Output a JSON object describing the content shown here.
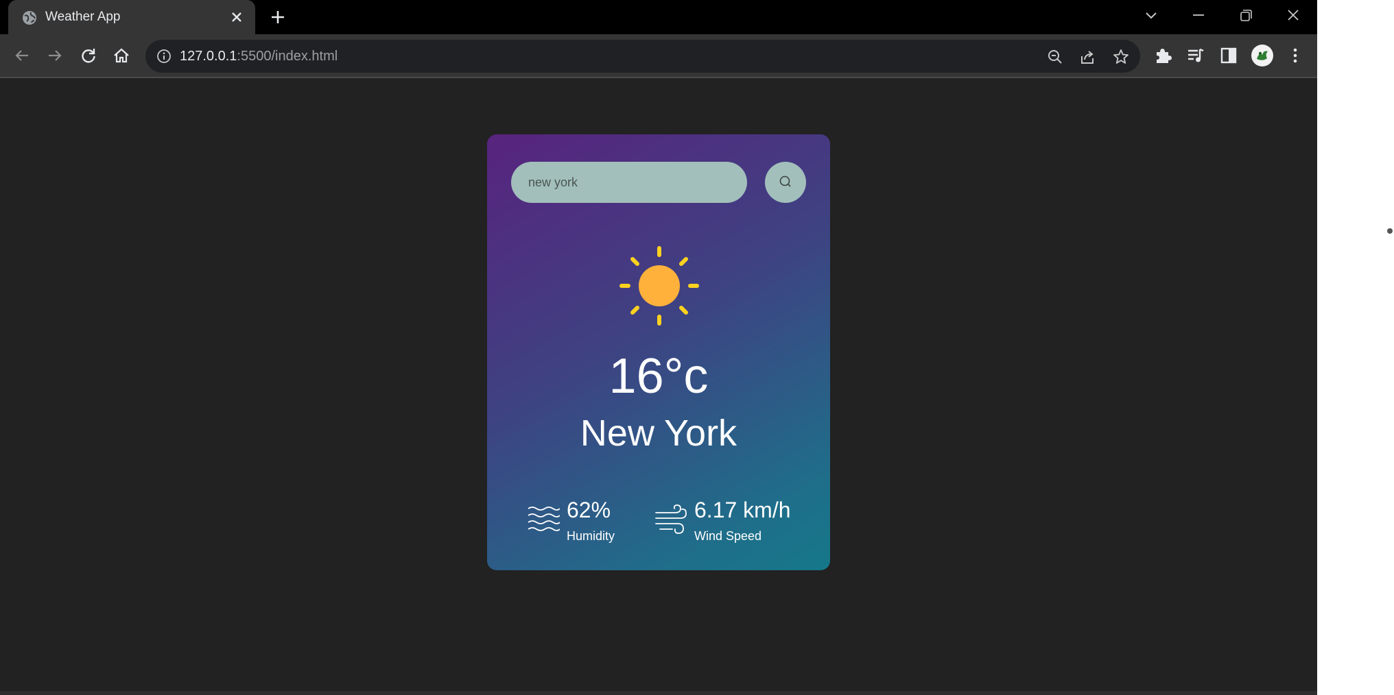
{
  "browser": {
    "tab_title": "Weather App",
    "url_host": "127.0.0.1",
    "url_rest": ":5500/index.html"
  },
  "app": {
    "search": {
      "value": "new york"
    },
    "temperature": "16°c",
    "city": "New York",
    "humidity": {
      "value": "62%",
      "label": "Humidity"
    },
    "wind": {
      "value": "6.17 km/h",
      "label": "Wind Speed"
    }
  },
  "icons": {
    "tab_favicon": "globe-icon",
    "tab_close": "close-icon",
    "new_tab": "plus-icon",
    "back": "arrow-left-icon",
    "forward": "arrow-right-icon",
    "reload": "reload-icon",
    "home": "home-icon",
    "site_info": "info-icon",
    "zoom": "zoom-out-icon",
    "share": "share-icon",
    "bookmark": "star-icon",
    "extensions": "puzzle-icon",
    "media": "media-queue-icon",
    "side_panel": "side-panel-icon",
    "menu": "more-vert-icon",
    "weather": "sun-icon",
    "search": "search-icon",
    "humidity": "waves-icon",
    "wind": "wind-icon"
  },
  "colors": {
    "card_gradient_start": "#58237e",
    "card_gradient_end": "#15788a",
    "input_bg": "#a2bfbb",
    "sun": "#ffb13b",
    "sun_rays": "#ffd21f",
    "page_bg": "#222222"
  }
}
